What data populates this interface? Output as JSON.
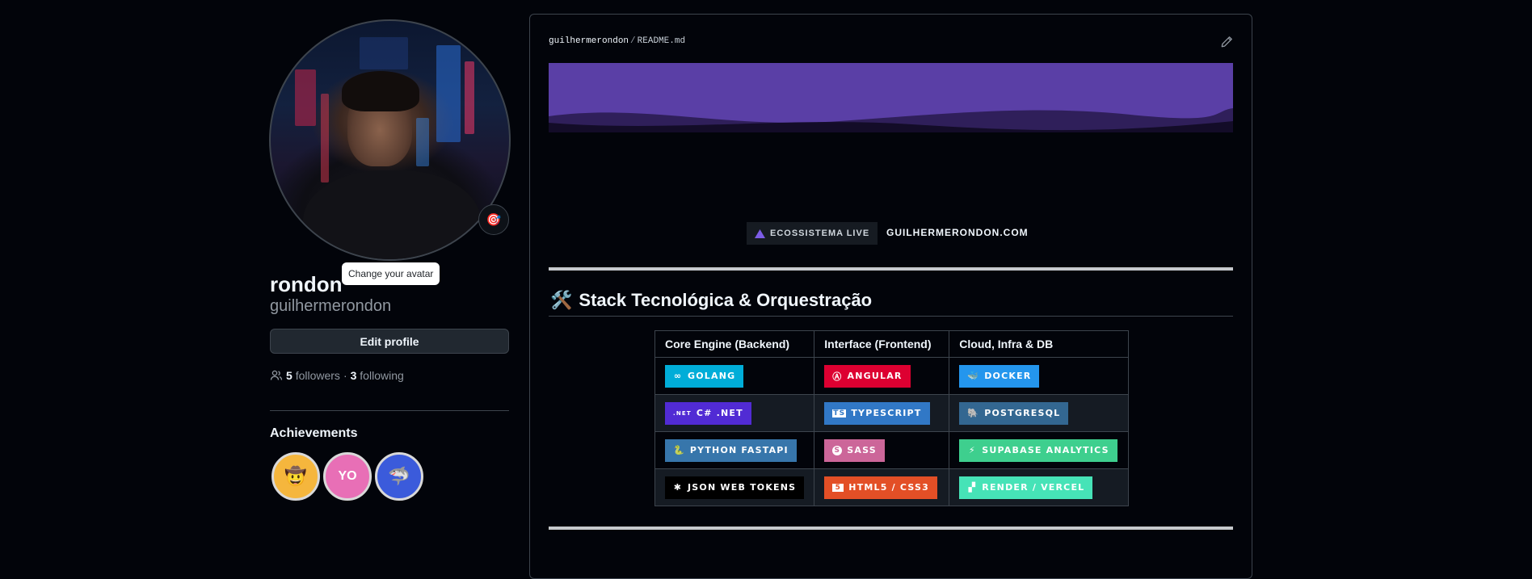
{
  "profile": {
    "full_name": "rondon",
    "username": "guilhermerondon",
    "tooltip": "Change your avatar",
    "status_emoji": "🎯",
    "edit_label": "Edit profile",
    "followers_count": "5",
    "followers_label": "followers",
    "separator": "·",
    "following_count": "3",
    "following_label": "following",
    "achievements_title": "Achievements",
    "achievements": [
      {
        "icon": "cowboy-face-icon",
        "glyph": "🤠",
        "color": "#f5b63d"
      },
      {
        "icon": "yolo-icon",
        "glyph": "YO",
        "color": "#e86fb6"
      },
      {
        "icon": "shark-icon",
        "glyph": "🦈",
        "color": "#3b5bdb"
      }
    ]
  },
  "readme": {
    "owner": "guilhermerondon",
    "path_sep": "/",
    "file": "README.md",
    "banner_color": "#5a3fa6",
    "live_label": "ECOSSISTEMA LIVE",
    "site_label": "GUILHERMERONDON.COM",
    "section_icon": "🛠️",
    "section_title": "Stack Tecnológica & Orquestração",
    "table": {
      "headers": [
        "Core Engine (Backend)",
        "Interface (Frontend)",
        "Cloud, Infra & DB"
      ],
      "rows": [
        [
          {
            "label": "GOLANG",
            "glyph": "∞",
            "icon": "go-icon",
            "color": "#00ADD8"
          },
          {
            "label": "ANGULAR",
            "glyph": "Ⓐ",
            "icon": "angular-icon",
            "color": "#DD0031"
          },
          {
            "label": "DOCKER",
            "glyph": "🐳",
            "icon": "docker-icon",
            "color": "#2496ED"
          }
        ],
        [
          {
            "label": "C# .NET",
            "glyph": ".NET",
            "icon": "dotnet-icon",
            "color": "#512BD4"
          },
          {
            "label": "TYPESCRIPT",
            "glyph": "TS",
            "icon": "typescript-icon",
            "color": "#3178C6"
          },
          {
            "label": "POSTGRESQL",
            "glyph": "🐘",
            "icon": "postgresql-icon",
            "color": "#336791"
          }
        ],
        [
          {
            "label": "PYTHON FASTAPI",
            "glyph": "🐍",
            "icon": "python-icon",
            "color": "#3776AB"
          },
          {
            "label": "SASS",
            "glyph": "S",
            "icon": "sass-icon",
            "color": "#CC6699"
          },
          {
            "label": "SUPABASE ANALYTICS",
            "glyph": "⚡",
            "icon": "supabase-icon",
            "color": "#3ECF8E"
          }
        ],
        [
          {
            "label": "JSON WEB TOKENS",
            "glyph": "✱",
            "icon": "jwt-icon",
            "color": "#000000"
          },
          {
            "label": "HTML5 / CSS3",
            "glyph": "5",
            "icon": "html5-icon",
            "color": "#E34F26"
          },
          {
            "label": "RENDER / VERCEL",
            "glyph": "▞",
            "icon": "render-icon",
            "color": "#46E3B7"
          }
        ]
      ]
    }
  }
}
